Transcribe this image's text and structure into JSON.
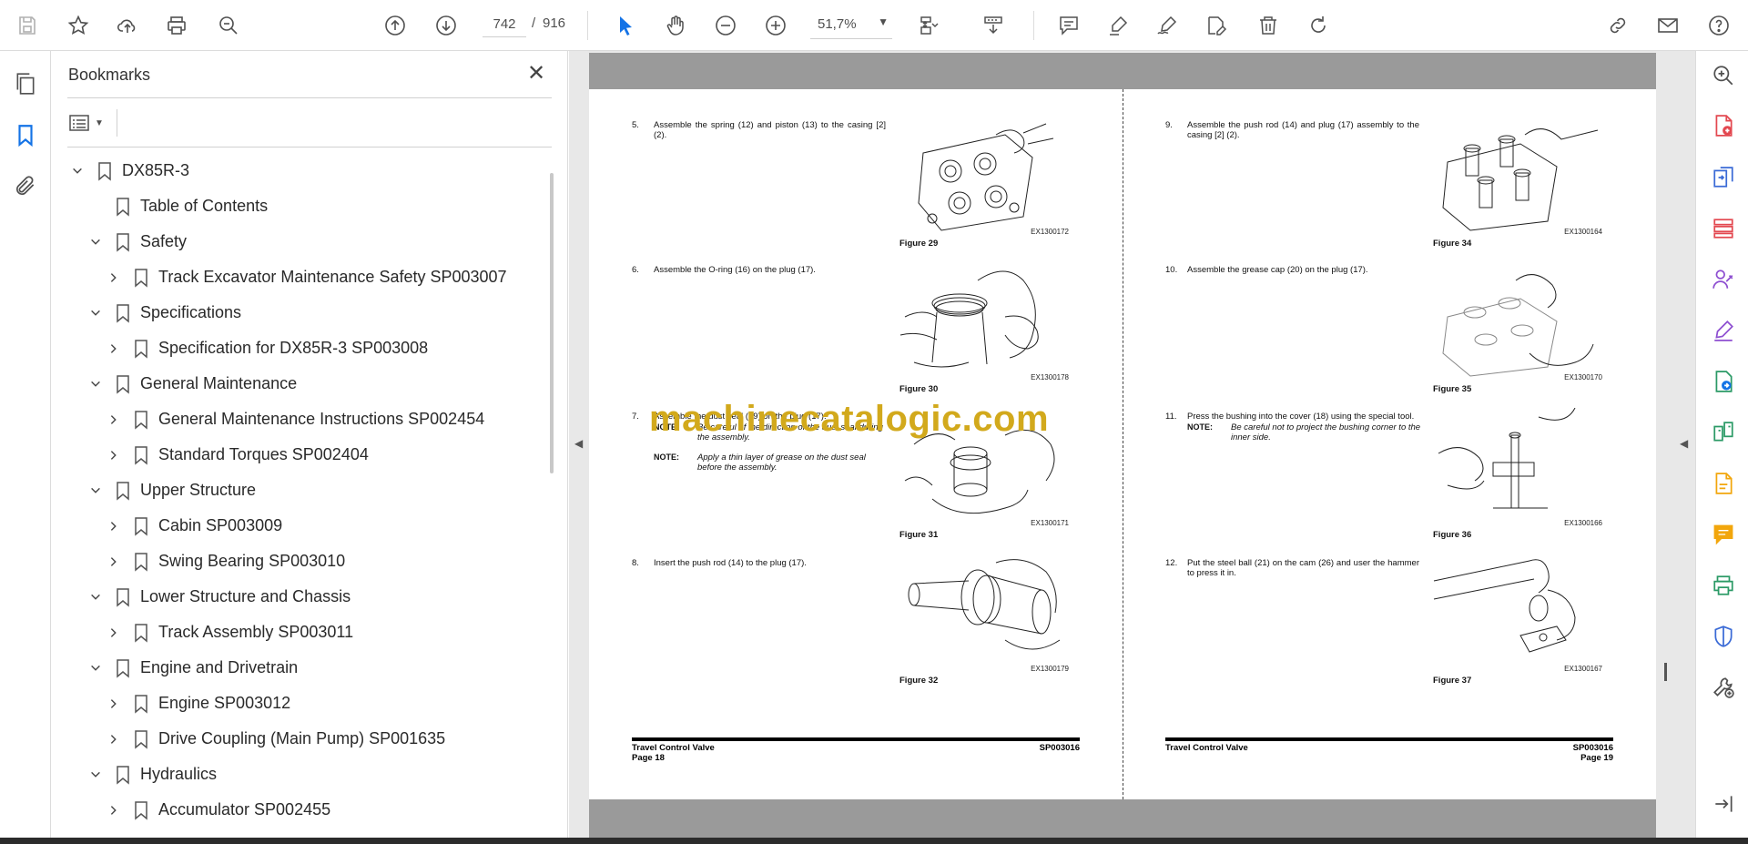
{
  "toolbar": {
    "page_current": "742",
    "page_sep": "/",
    "page_total": "916",
    "zoom": "51,7%"
  },
  "bookmarks": {
    "title": "Bookmarks",
    "items": [
      {
        "label": "DX85R-3",
        "level": 0,
        "twisty": "open"
      },
      {
        "label": "Table of Contents",
        "level": 1,
        "twisty": "none"
      },
      {
        "label": "Safety",
        "level": 1,
        "twisty": "open"
      },
      {
        "label": "Track Excavator Maintenance Safety SP003007",
        "level": 2,
        "twisty": "closed"
      },
      {
        "label": "Specifications",
        "level": 1,
        "twisty": "open"
      },
      {
        "label": "Specification for DX85R-3 SP003008",
        "level": 2,
        "twisty": "closed"
      },
      {
        "label": "General Maintenance",
        "level": 1,
        "twisty": "open"
      },
      {
        "label": "General Maintenance Instructions SP002454",
        "level": 2,
        "twisty": "closed"
      },
      {
        "label": "Standard Torques SP002404",
        "level": 2,
        "twisty": "closed"
      },
      {
        "label": "Upper Structure",
        "level": 1,
        "twisty": "open"
      },
      {
        "label": "Cabin SP003009",
        "level": 2,
        "twisty": "closed"
      },
      {
        "label": "Swing Bearing SP003010",
        "level": 2,
        "twisty": "closed"
      },
      {
        "label": "Lower Structure and Chassis",
        "level": 1,
        "twisty": "open"
      },
      {
        "label": "Track Assembly SP003011",
        "level": 2,
        "twisty": "closed"
      },
      {
        "label": "Engine and Drivetrain",
        "level": 1,
        "twisty": "open"
      },
      {
        "label": "Engine SP003012",
        "level": 2,
        "twisty": "closed"
      },
      {
        "label": "Drive Coupling (Main Pump) SP001635",
        "level": 2,
        "twisty": "closed"
      },
      {
        "label": "Hydraulics",
        "level": 1,
        "twisty": "open"
      },
      {
        "label": "Accumulator SP002455",
        "level": 2,
        "twisty": "closed"
      }
    ]
  },
  "document": {
    "watermark": "machinecatalogic.com",
    "left_page": {
      "steps": [
        {
          "num": "5.",
          "text": "Assemble the spring (12) and piston (13) to the casing [2] (2).",
          "figure": "Figure 29",
          "code": "EX1300172"
        },
        {
          "num": "6.",
          "text": "Assemble the O-ring (16) on the plug (17).",
          "figure": "Figure 30",
          "code": "EX1300178"
        },
        {
          "num": "7.",
          "text": "Assemble the dust seal (19) on the plug (17).",
          "figure": "Figure 31",
          "code": "EX1300171",
          "notes": [
            {
              "label": "NOTE:",
              "text": "Be careful of the direction of the dust seal during the assembly."
            },
            {
              "label": "NOTE:",
              "text": "Apply a thin layer of grease on the dust seal before the assembly."
            }
          ]
        },
        {
          "num": "8.",
          "text": "Insert the push rod (14) to the plug (17).",
          "figure": "Figure 32",
          "code": "EX1300179"
        }
      ],
      "footer_title": "Travel Control Valve",
      "footer_page": "Page 18",
      "footer_code": "SP003016"
    },
    "right_page": {
      "steps": [
        {
          "num": "9.",
          "text": "Assemble the push rod (14) and plug (17) assembly to the casing [2] (2).",
          "figure": "Figure 34",
          "code": "EX1300164"
        },
        {
          "num": "10.",
          "text": "Assemble the grease cap (20) on the plug (17).",
          "figure": "Figure 35",
          "code": "EX1300170"
        },
        {
          "num": "11.",
          "text": "Press the bushing into the cover (18) using the special tool.",
          "figure": "Figure 36",
          "code": "EX1300166",
          "notes": [
            {
              "label": "NOTE:",
              "text": "Be careful not to project the bushing corner to the inner side."
            }
          ]
        },
        {
          "num": "12.",
          "text": "Put the steel ball (21) on the cam (26) and user the hammer to press it in.",
          "figure": "Figure 37",
          "code": "EX1300167"
        }
      ],
      "footer_title": "Travel Control Valve",
      "footer_page": "Page 19",
      "footer_code": "SP003016"
    }
  },
  "colors": {
    "accent_blue": "#1473e6",
    "right_tool_red": "#e34850",
    "right_tool_purple": "#8e4fd1",
    "watermark": "#d2a91c"
  }
}
